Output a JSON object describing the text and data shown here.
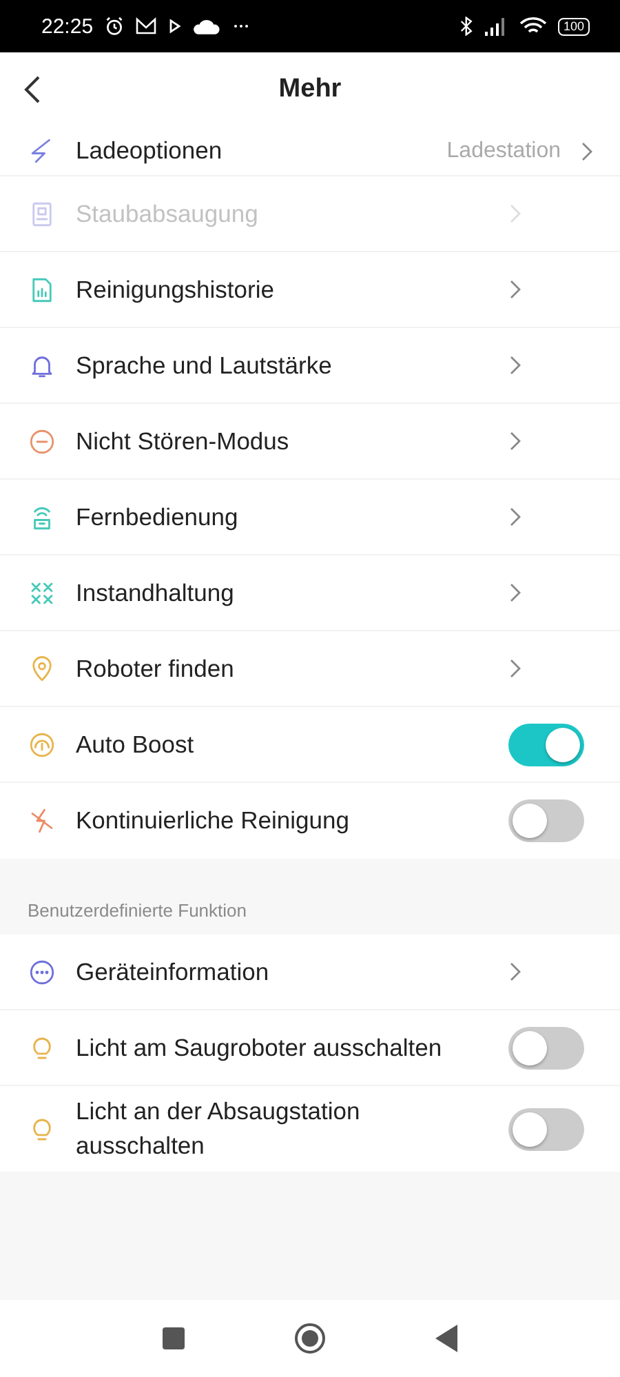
{
  "status_bar": {
    "time": "22:25",
    "battery": "100"
  },
  "header": {
    "title": "Mehr"
  },
  "sections": [
    {
      "items": [
        {
          "label": "Ladeoptionen",
          "value": "Ladestation",
          "kind": "link",
          "disabled": false
        },
        {
          "label": "Staubabsaugung",
          "kind": "link",
          "disabled": true
        },
        {
          "label": "Reinigungshistorie",
          "kind": "link",
          "disabled": false
        },
        {
          "label": "Sprache und Lautstärke",
          "kind": "link",
          "disabled": false
        },
        {
          "label": "Nicht Stören-Modus",
          "kind": "link",
          "disabled": false
        },
        {
          "label": "Fernbedienung",
          "kind": "link",
          "disabled": false
        },
        {
          "label": "Instandhaltung",
          "kind": "link",
          "disabled": false
        },
        {
          "label": "Roboter finden",
          "kind": "link",
          "disabled": false
        },
        {
          "label": "Auto Boost",
          "kind": "toggle",
          "on": true,
          "disabled": false
        },
        {
          "label": "Kontinuierliche Reinigung",
          "kind": "toggle",
          "on": false,
          "disabled": false
        }
      ]
    },
    {
      "title": "Benutzerdefinierte Funktion",
      "items": [
        {
          "label": "Geräteinformation",
          "kind": "link",
          "disabled": false
        },
        {
          "label": "Licht am Saugroboter ausschalten",
          "kind": "toggle",
          "on": false,
          "disabled": false
        },
        {
          "label": "Licht an der Absaugstation ausschalten",
          "kind": "toggle",
          "on": false,
          "disabled": false
        }
      ]
    }
  ]
}
